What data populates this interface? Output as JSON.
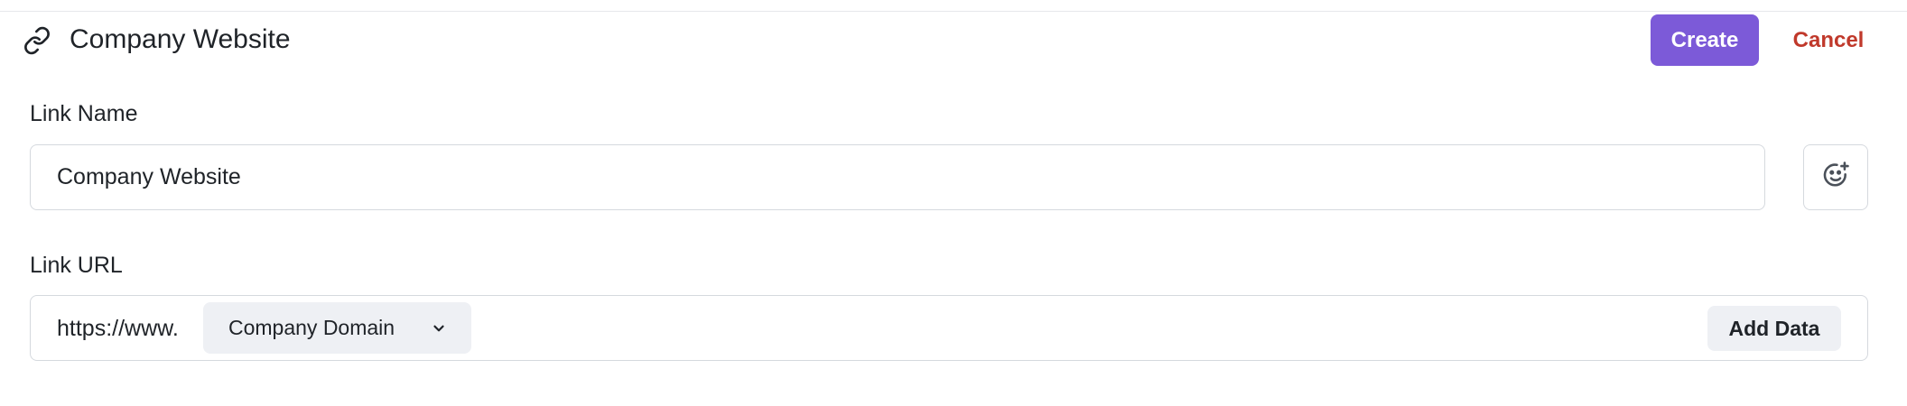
{
  "header": {
    "title": "Company Website",
    "create_label": "Create",
    "cancel_label": "Cancel"
  },
  "link_name": {
    "label": "Link Name",
    "value": "Company Website"
  },
  "link_url": {
    "label": "Link URL",
    "prefix": "https://www.",
    "domain_chip": "Company Domain",
    "add_data_label": "Add Data"
  },
  "colors": {
    "accent": "#7c5ad8",
    "danger": "#c0392b",
    "chip_bg": "#eef0f4",
    "border": "#d5d9de"
  },
  "icons": {
    "header": "link-icon",
    "emoji": "emoji-add-icon",
    "chip": "chevron-down-icon"
  }
}
